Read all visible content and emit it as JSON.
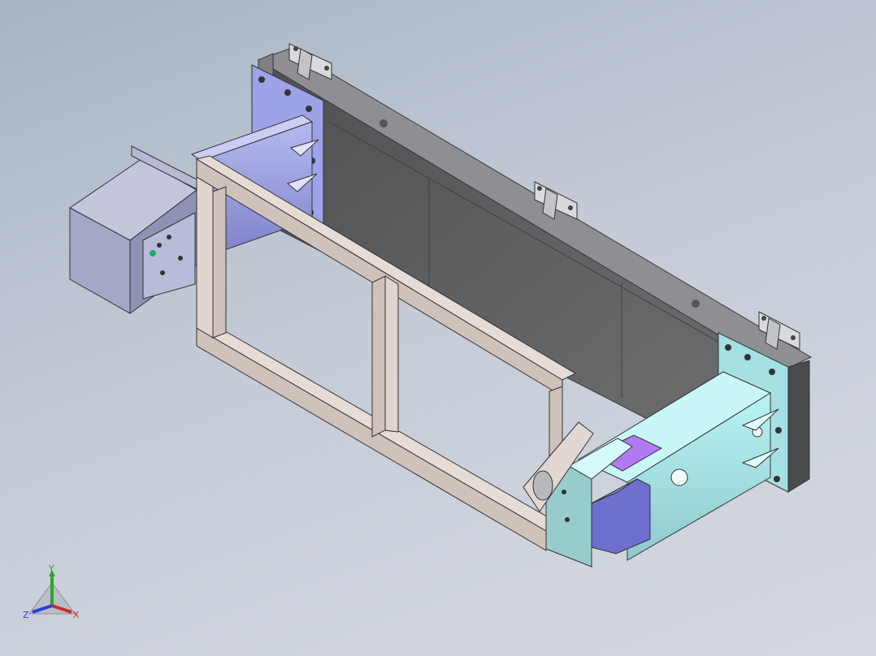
{
  "viewport": {
    "background_top": "#a9b4c4",
    "background_bottom": "#d6dae1"
  },
  "triad": {
    "x_label": "X",
    "y_label": "Y",
    "z_label": "Z",
    "x_color": "#d42a2a",
    "y_color": "#2aa52a",
    "z_color": "#2a3fd4"
  },
  "model": {
    "panel_color": "#5e5f61",
    "frame_color": "#d9cdc7",
    "bracket_left_color": "#9aa0e0",
    "bracket_right_color": "#a8e3e6",
    "box_color": "#a6abc9",
    "wedge_color": "#6e6fcf",
    "accent_color": "#b27af0"
  }
}
